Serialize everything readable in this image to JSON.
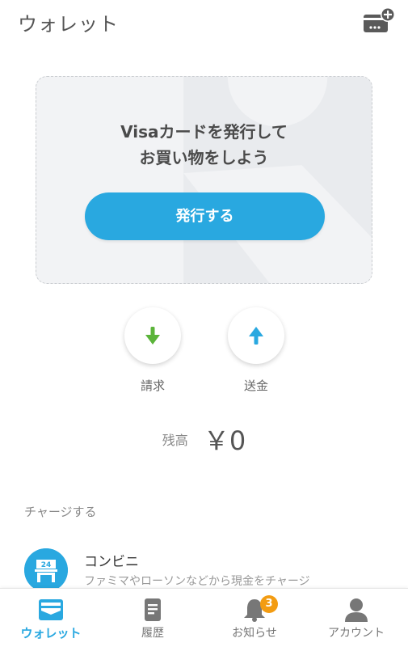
{
  "header": {
    "title": "ウォレット",
    "add_card_icon": "card-add-icon"
  },
  "card_promo": {
    "line1": "Visaカードを発行して",
    "line2": "お買い物をしよう",
    "button_label": "発行する"
  },
  "actions": [
    {
      "label": "請求",
      "icon": "arrow-down-icon",
      "color": "#5bb43a"
    },
    {
      "label": "送金",
      "icon": "arrow-up-icon",
      "color": "#29a8e0"
    }
  ],
  "balance": {
    "label": "残高",
    "value": "￥0"
  },
  "charge": {
    "section_title": "チャージする",
    "items": [
      {
        "title": "コンビニ",
        "subtitle": "ファミマやローソンなどから現金をチャージ",
        "icon": "convenience-store-icon",
        "icon_text": "24"
      }
    ]
  },
  "tabbar": {
    "tabs": [
      {
        "label": "ウォレット",
        "icon": "wallet-icon",
        "active": true
      },
      {
        "label": "履歴",
        "icon": "history-icon",
        "active": false
      },
      {
        "label": "お知らせ",
        "icon": "bell-icon",
        "active": false,
        "badge": "3"
      },
      {
        "label": "アカウント",
        "icon": "account-icon",
        "active": false
      }
    ]
  },
  "colors": {
    "accent": "#29a8e0",
    "request_green": "#5bb43a",
    "badge_orange": "#f39c12"
  }
}
